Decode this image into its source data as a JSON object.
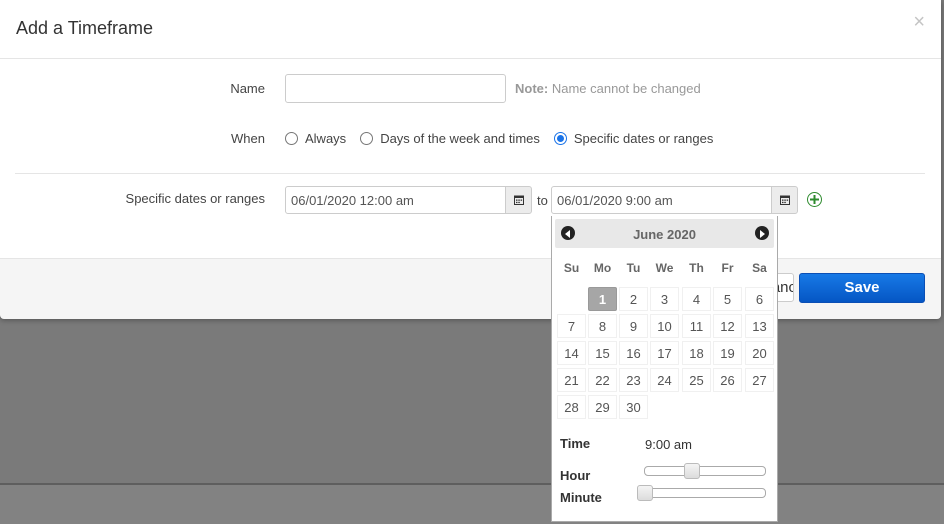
{
  "dialog": {
    "title": "Add a Timeframe",
    "close_label": "×"
  },
  "form": {
    "name": {
      "label": "Name",
      "value": "",
      "note_bold": "Note:",
      "note_text": " Name cannot be changed"
    },
    "when": {
      "label": "When",
      "options": [
        {
          "label": "Always",
          "checked": false
        },
        {
          "label": "Days of the week and times",
          "checked": false
        },
        {
          "label": "Specific dates or ranges",
          "checked": true
        }
      ]
    },
    "range": {
      "label": "Specific dates or ranges",
      "start": "06/01/2020 12:00 am",
      "to_label": "to",
      "end": "06/01/2020 9:00 am"
    }
  },
  "footer": {
    "cancel_label": "Cancel",
    "save_label": "Save"
  },
  "datepicker": {
    "title": "June 2020",
    "weekdays": [
      "Su",
      "Mo",
      "Tu",
      "We",
      "Th",
      "Fr",
      "Sa"
    ],
    "weeks": [
      [
        "",
        "1",
        "2",
        "3",
        "4",
        "5",
        "6"
      ],
      [
        "7",
        "8",
        "9",
        "10",
        "11",
        "12",
        "13"
      ],
      [
        "14",
        "15",
        "16",
        "17",
        "18",
        "19",
        "20"
      ],
      [
        "21",
        "22",
        "23",
        "24",
        "25",
        "26",
        "27"
      ],
      [
        "28",
        "29",
        "30",
        "",
        "",
        "",
        ""
      ]
    ],
    "selected_day": "1",
    "time_label": "Time",
    "time_value": "9:00 am",
    "hour_label": "Hour",
    "minute_label": "Minute",
    "hour": 9,
    "minute": 0
  },
  "colors": {
    "primary": "#0a62d6",
    "add_icon": "#2e8b2e",
    "backdrop": "#7a7a7a"
  }
}
